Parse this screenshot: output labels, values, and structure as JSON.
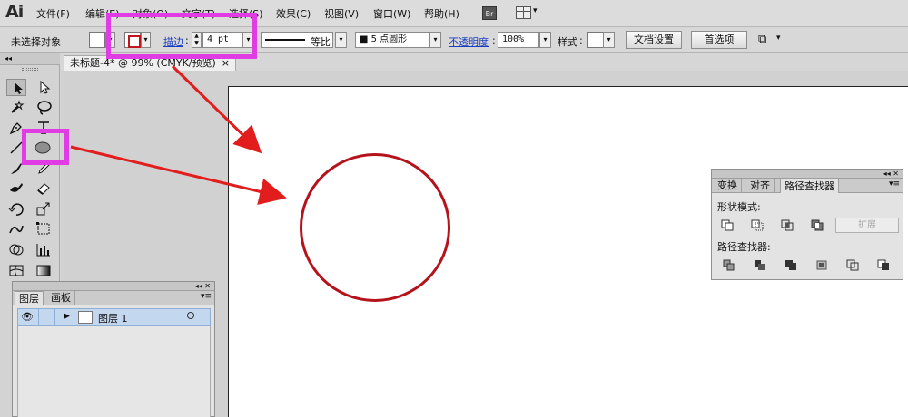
{
  "app": {
    "logo": "Ai"
  },
  "menu": {
    "items": [
      "文件(F)",
      "编辑(E)",
      "对象(O)",
      "文字(T)",
      "选择(S)",
      "效果(C)",
      "视图(V)",
      "窗口(W)",
      "帮助(H)"
    ],
    "bridge_badge": "Br"
  },
  "control_bar": {
    "selection_label": "未选择对象",
    "stroke_label": "描边",
    "stroke_weight": "4 pt",
    "profile_label": "等比",
    "brush_label": "5 点圆形",
    "opacity_label": "不透明度",
    "opacity_value": "100%",
    "style_label": "样式",
    "doc_setup_button": "文档设置",
    "preferences_button": "首选项"
  },
  "document": {
    "tab_title": "未标题-4* @ 99% (CMYK/预览)",
    "tab_close": "×"
  },
  "pathfinder_panel": {
    "tabs": [
      "变换",
      "对齐",
      "路径查找器"
    ],
    "shape_modes_label": "形状模式",
    "expand_button": "扩展",
    "pathfinders_label": "路径查找器"
  },
  "layers_panel": {
    "tabs": [
      "图层",
      "画板"
    ],
    "layer_name": "图层 1"
  },
  "colors": {
    "stroke": "#b5121b",
    "highlight": "#e13be3",
    "arrow": "#e11d1d",
    "selection_row": "#c3d7ee"
  },
  "icons": [
    "selection-tool-icon",
    "direct-selection-tool-icon",
    "magic-wand-icon",
    "lasso-icon",
    "pen-tool-icon",
    "type-tool-icon",
    "line-tool-icon",
    "ellipse-tool-icon",
    "paintbrush-icon",
    "pencil-icon",
    "blob-brush-icon",
    "eraser-icon",
    "rotate-icon",
    "scale-icon",
    "warp-icon",
    "free-transform-icon",
    "shape-builder-icon",
    "graph-icon",
    "mesh-icon",
    "gradient-icon",
    "eye-icon"
  ]
}
